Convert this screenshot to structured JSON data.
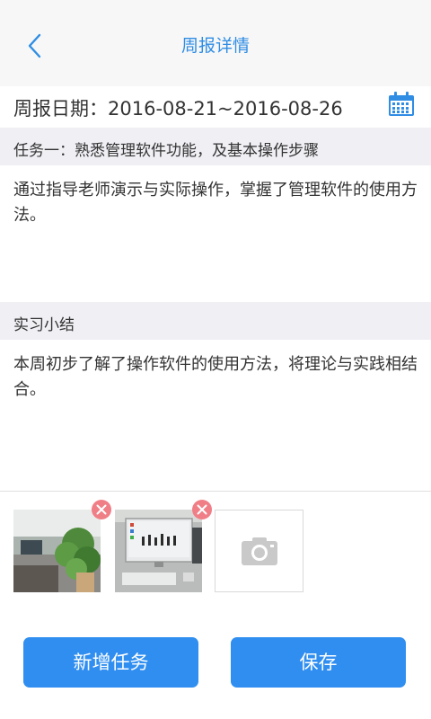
{
  "header": {
    "title": "周报详情",
    "back_icon": "chevron-left-icon"
  },
  "report": {
    "date_label": "周报日期：2016-08-21~2016-08-26",
    "calendar_icon": "calendar-icon"
  },
  "task": {
    "header": "任务一：熟悉管理软件功能，及基本操作步骤",
    "content": "通过指导老师演示与实际操作，掌握了管理软件的使用方法。"
  },
  "summary": {
    "header": "实习小结",
    "content": "本周初步了解了操作软件的使用方法，将理论与实践相结合。"
  },
  "photos": {
    "remove_icon": "close-icon",
    "add_icon": "camera-icon"
  },
  "actions": {
    "add_task_label": "新增任务",
    "save_label": "保存"
  },
  "colors": {
    "accent": "#2f8ef0",
    "title": "#2f8de4",
    "remove_badge": "#f07e86",
    "section_bg": "#efeff4"
  }
}
